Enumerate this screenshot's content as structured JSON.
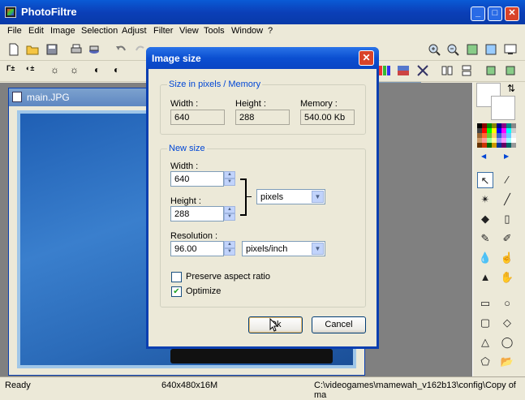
{
  "app": {
    "title": "PhotoFiltre"
  },
  "menu": [
    "File",
    "Edit",
    "Image",
    "Selection",
    "Adjust",
    "Filter",
    "View",
    "Tools",
    "Window",
    "?"
  ],
  "toolbar": {
    "zoom_value": "%"
  },
  "document": {
    "title": "main.JPG"
  },
  "dialog": {
    "title": "Image size",
    "size_group": {
      "label": "Size in pixels / Memory",
      "width_label": "Width :",
      "height_label": "Height :",
      "memory_label": "Memory :",
      "width_value": "640",
      "height_value": "288",
      "memory_value": "540.00 Kb"
    },
    "new_group": {
      "label": "New size",
      "width_label": "Width :",
      "width_value": "640",
      "height_label": "Height :",
      "height_value": "288",
      "unit_value": "pixels",
      "resolution_label": "Resolution :",
      "resolution_value": "96.00",
      "resolution_unit": "pixels/inch",
      "preserve_label": "Preserve aspect ratio",
      "preserve_checked": false,
      "optimize_label": "Optimize",
      "optimize_checked": true
    },
    "ok_label": "Ok",
    "cancel_label": "Cancel"
  },
  "status": {
    "ready": "Ready",
    "dims": "640x480x16M",
    "path": "C:\\videogames\\mamewah_v162b13\\config\\Copy of ma"
  },
  "colors": {
    "title_blue": "#0a5bd6",
    "dialog_label_blue": "#0046d5",
    "close_red": "#d9432a"
  }
}
